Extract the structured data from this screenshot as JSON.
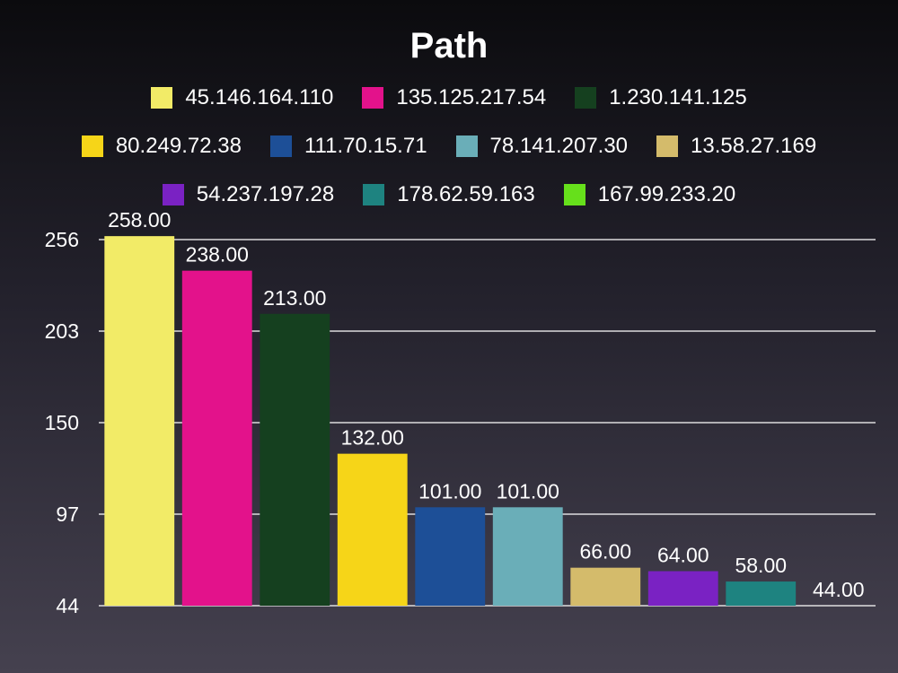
{
  "chart_data": {
    "type": "bar",
    "title": "Path",
    "xlabel": "",
    "ylabel": "",
    "categories": [
      "45.146.164.110",
      "135.125.217.54",
      "1.230.141.125",
      "80.249.72.38",
      "111.70.15.71",
      "78.141.207.30",
      "13.58.27.169",
      "54.237.197.28",
      "178.62.59.163",
      "167.99.233.20"
    ],
    "values": [
      258,
      238,
      213,
      132,
      101,
      101,
      66,
      64,
      58,
      44
    ],
    "value_labels": [
      "258.00",
      "238.00",
      "213.00",
      "132.00",
      "101.00",
      "101.00",
      "66.00",
      "64.00",
      "58.00",
      "44.00"
    ],
    "colors": [
      "#f2eb67",
      "#e3128b",
      "#15401f",
      "#f6d518",
      "#1d4f97",
      "#6aaeb8",
      "#d4bb6b",
      "#7a22c3",
      "#1e8380",
      "#66e01b"
    ],
    "ylim": [
      44,
      256
    ],
    "yticks": [
      44,
      97,
      150,
      203,
      256
    ],
    "grid": true,
    "legend_position": "top"
  }
}
